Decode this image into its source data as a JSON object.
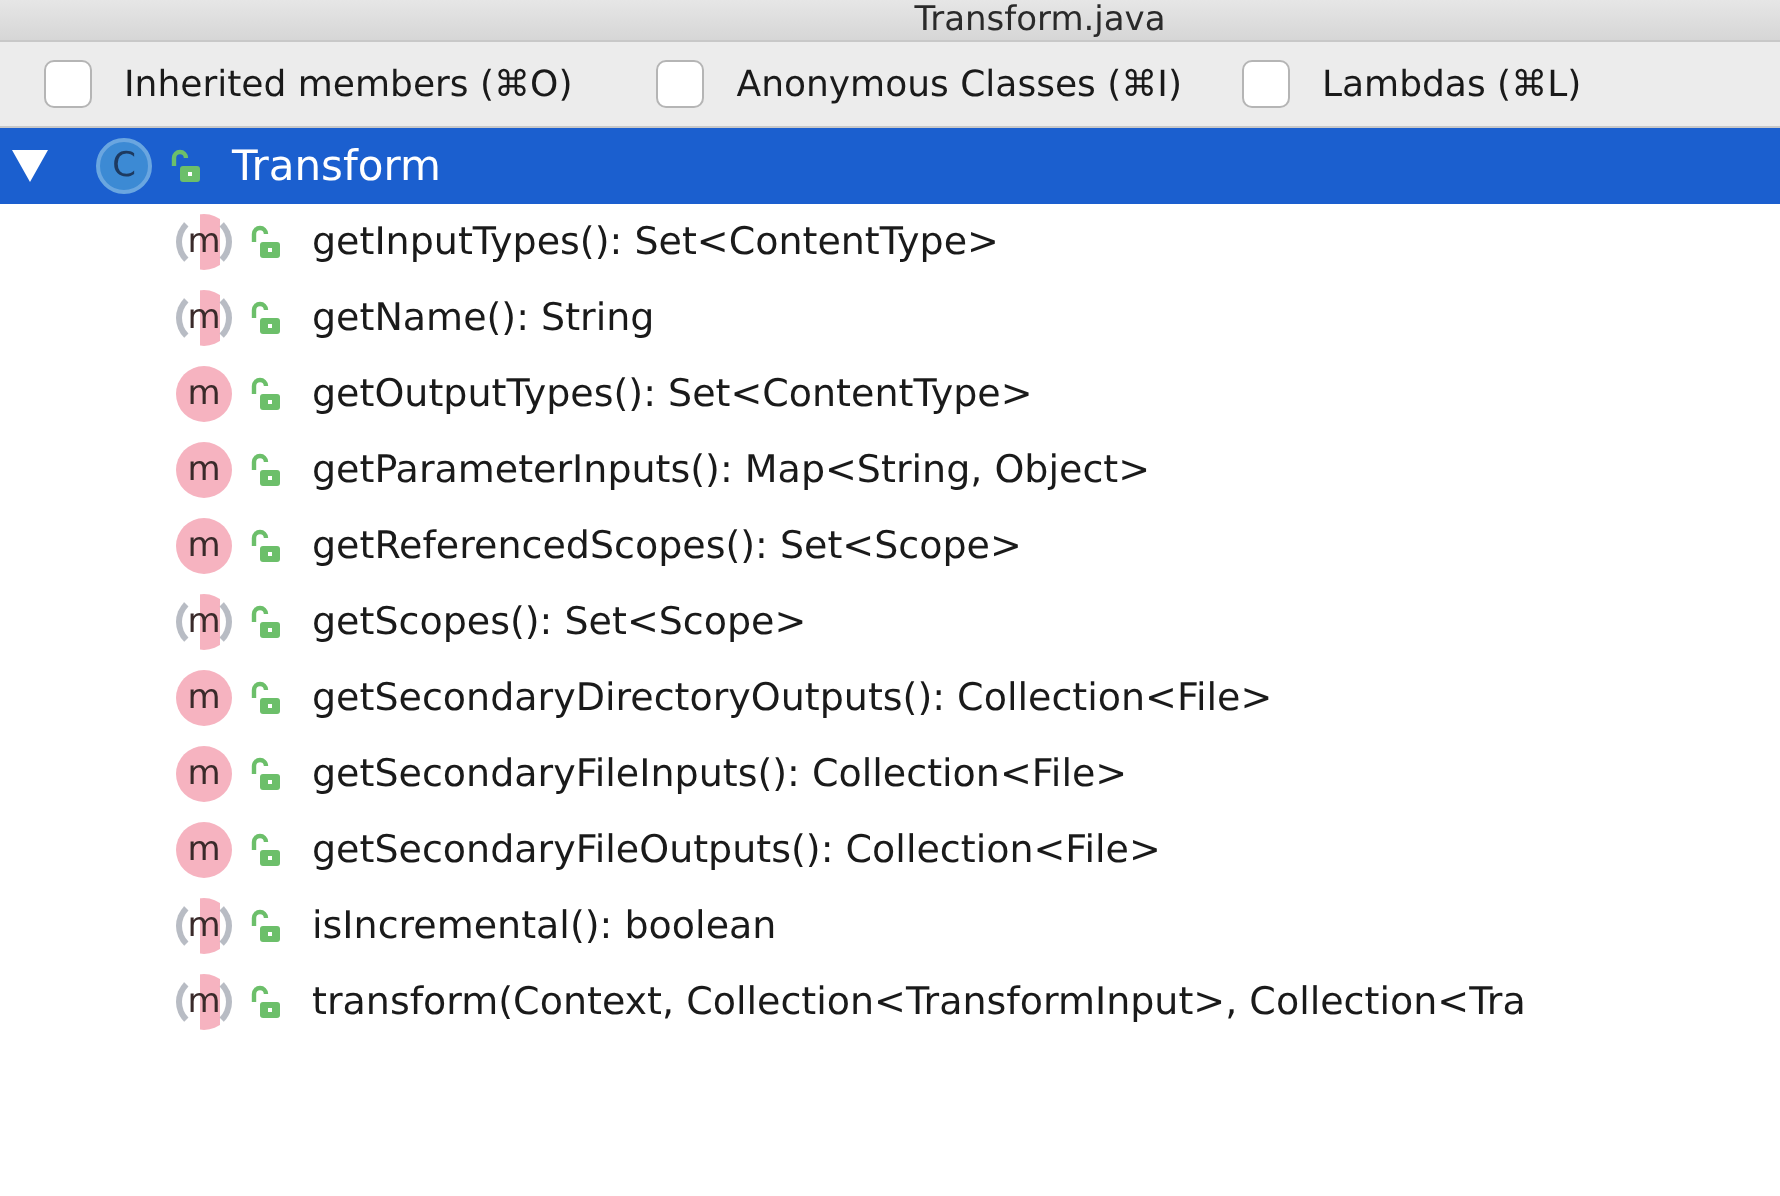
{
  "window": {
    "title": "Transform.java"
  },
  "filters": [
    {
      "label": "Inherited members (⌘O)",
      "checked": false
    },
    {
      "label": "Anonymous Classes (⌘I)",
      "checked": false
    },
    {
      "label": "Lambdas (⌘L)",
      "checked": false
    }
  ],
  "tree": {
    "label": "Transform",
    "icon_letter": "C",
    "expanded": true,
    "selected": true,
    "children": [
      {
        "kind": "abstract",
        "icon_letter": "m",
        "label": "getInputTypes(): Set<ContentType>",
        "selected": false
      },
      {
        "kind": "abstract",
        "icon_letter": "m",
        "label": "getName(): String",
        "selected": false
      },
      {
        "kind": "method",
        "icon_letter": "m",
        "label": "getOutputTypes(): Set<ContentType>",
        "selected": false
      },
      {
        "kind": "method",
        "icon_letter": "m",
        "label": "getParameterInputs(): Map<String, Object>",
        "selected": false
      },
      {
        "kind": "method",
        "icon_letter": "m",
        "label": "getReferencedScopes(): Set<Scope>",
        "selected": false
      },
      {
        "kind": "abstract",
        "icon_letter": "m",
        "label": "getScopes(): Set<Scope>",
        "selected": false
      },
      {
        "kind": "method",
        "icon_letter": "m",
        "label": "getSecondaryDirectoryOutputs(): Collection<File>",
        "selected": false
      },
      {
        "kind": "method",
        "icon_letter": "m",
        "label": "getSecondaryFileInputs(): Collection<File>",
        "selected": false
      },
      {
        "kind": "method",
        "icon_letter": "m",
        "label": "getSecondaryFileOutputs(): Collection<File>",
        "selected": false
      },
      {
        "kind": "abstract",
        "icon_letter": "m",
        "label": "isIncremental(): boolean",
        "selected": false
      },
      {
        "kind": "abstract",
        "icon_letter": "m",
        "label": "transform(Context, Collection<TransformInput>, Collection<Tra",
        "selected": false
      }
    ]
  }
}
